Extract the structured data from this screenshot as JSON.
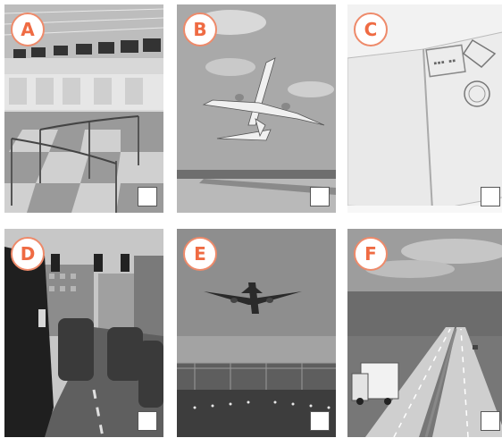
{
  "options": [
    {
      "letter": "A",
      "scene": "airport check-in hall"
    },
    {
      "letter": "B",
      "scene": "airplane taking off"
    },
    {
      "letter": "C",
      "scene": "stamped passport"
    },
    {
      "letter": "D",
      "scene": "traffic jam"
    },
    {
      "letter": "E",
      "scene": "airplane landing"
    },
    {
      "letter": "F",
      "scene": "highway with truck"
    }
  ],
  "colors": {
    "badge_text": "#ef6b43",
    "badge_border": "#ee8a6a"
  }
}
